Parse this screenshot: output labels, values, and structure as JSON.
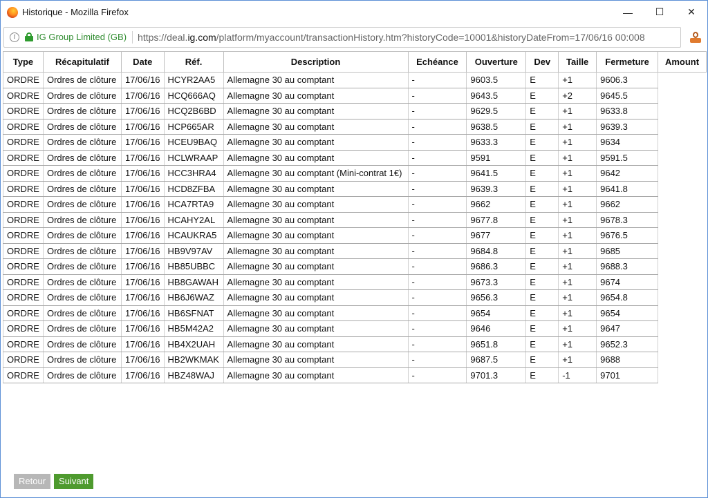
{
  "window": {
    "title": "Historique - Mozilla Firefox"
  },
  "controls": {
    "minimize": "—",
    "maximize": "☐",
    "close": "✕"
  },
  "url": {
    "site": "IG Group Limited (GB)",
    "prefix": "https://deal.",
    "domain": "ig.com",
    "path": "/platform/myaccount/transactionHistory.htm?historyCode=10001&historyDateFrom=17/06/16 00:008"
  },
  "table": {
    "headers": [
      "Type",
      "Récapitulatif",
      "Date",
      "Réf.",
      "Description",
      "Echéance",
      "Ouverture",
      "Dev",
      "Taille",
      "Fermeture",
      "Amount"
    ],
    "rows": [
      [
        "ORDRE",
        "Ordres de clôture",
        "17/06/16",
        "HCYR2AA5",
        "Allemagne 30 au comptant",
        "-",
        "9603.5",
        "E",
        "+1",
        "9606.3",
        ""
      ],
      [
        "ORDRE",
        "Ordres de clôture",
        "17/06/16",
        "HCQ666AQ",
        "Allemagne 30 au comptant",
        "-",
        "9643.5",
        "E",
        "+2",
        "9645.5",
        ""
      ],
      [
        "ORDRE",
        "Ordres de clôture",
        "17/06/16",
        "HCQ2B6BD",
        "Allemagne 30 au comptant",
        "-",
        "9629.5",
        "E",
        "+1",
        "9633.8",
        ""
      ],
      [
        "ORDRE",
        "Ordres de clôture",
        "17/06/16",
        "HCP665AR",
        "Allemagne 30 au comptant",
        "-",
        "9638.5",
        "E",
        "+1",
        "9639.3",
        ""
      ],
      [
        "ORDRE",
        "Ordres de clôture",
        "17/06/16",
        "HCEU9BAQ",
        "Allemagne 30 au comptant",
        "-",
        "9633.3",
        "E",
        "+1",
        "9634",
        ""
      ],
      [
        "ORDRE",
        "Ordres de clôture",
        "17/06/16",
        "HCLWRAAP",
        "Allemagne 30 au comptant",
        "-",
        "9591",
        "E",
        "+1",
        "9591.5",
        ""
      ],
      [
        "ORDRE",
        "Ordres de clôture",
        "17/06/16",
        "HCC3HRA4",
        "Allemagne 30 au comptant (Mini-contrat 1€)",
        "-",
        "9641.5",
        "E",
        "+1",
        "9642",
        ""
      ],
      [
        "ORDRE",
        "Ordres de clôture",
        "17/06/16",
        "HCD8ZFBA",
        "Allemagne 30 au comptant",
        "-",
        "9639.3",
        "E",
        "+1",
        "9641.8",
        ""
      ],
      [
        "ORDRE",
        "Ordres de clôture",
        "17/06/16",
        "HCA7RTA9",
        "Allemagne 30 au comptant",
        "-",
        "9662",
        "E",
        "+1",
        "9662",
        ""
      ],
      [
        "ORDRE",
        "Ordres de clôture",
        "17/06/16",
        "HCAHY2AL",
        "Allemagne 30 au comptant",
        "-",
        "9677.8",
        "E",
        "+1",
        "9678.3",
        ""
      ],
      [
        "ORDRE",
        "Ordres de clôture",
        "17/06/16",
        "HCAUKRA5",
        "Allemagne 30 au comptant",
        "-",
        "9677",
        "E",
        "+1",
        "9676.5",
        ""
      ],
      [
        "ORDRE",
        "Ordres de clôture",
        "17/06/16",
        "HB9V97AV",
        "Allemagne 30 au comptant",
        "-",
        "9684.8",
        "E",
        "+1",
        "9685",
        ""
      ],
      [
        "ORDRE",
        "Ordres de clôture",
        "17/06/16",
        "HB85UBBC",
        "Allemagne 30 au comptant",
        "-",
        "9686.3",
        "E",
        "+1",
        "9688.3",
        ""
      ],
      [
        "ORDRE",
        "Ordres de clôture",
        "17/06/16",
        "HB8GAWAH",
        "Allemagne 30 au comptant",
        "-",
        "9673.3",
        "E",
        "+1",
        "9674",
        ""
      ],
      [
        "ORDRE",
        "Ordres de clôture",
        "17/06/16",
        "HB6J6WAZ",
        "Allemagne 30 au comptant",
        "-",
        "9656.3",
        "E",
        "+1",
        "9654.8",
        ""
      ],
      [
        "ORDRE",
        "Ordres de clôture",
        "17/06/16",
        "HB6SFNAT",
        "Allemagne 30 au comptant",
        "-",
        "9654",
        "E",
        "+1",
        "9654",
        ""
      ],
      [
        "ORDRE",
        "Ordres de clôture",
        "17/06/16",
        "HB5M42A2",
        "Allemagne 30 au comptant",
        "-",
        "9646",
        "E",
        "+1",
        "9647",
        ""
      ],
      [
        "ORDRE",
        "Ordres de clôture",
        "17/06/16",
        "HB4X2UAH",
        "Allemagne 30 au comptant",
        "-",
        "9651.8",
        "E",
        "+1",
        "9652.3",
        ""
      ],
      [
        "ORDRE",
        "Ordres de clôture",
        "17/06/16",
        "HB2WKMAK",
        "Allemagne 30 au comptant",
        "-",
        "9687.5",
        "E",
        "+1",
        "9688",
        ""
      ],
      [
        "ORDRE",
        "Ordres de clôture",
        "17/06/16",
        "HBZ48WAJ",
        "Allemagne 30 au comptant",
        "-",
        "9701.3",
        "E",
        "-1",
        "9701",
        ""
      ]
    ]
  },
  "buttons": {
    "back": "Retour",
    "next": "Suivant"
  },
  "colors": {
    "next_button": "#4e9a2e",
    "back_button": "#b7b7b7",
    "secure_site": "#2e8b2e"
  }
}
